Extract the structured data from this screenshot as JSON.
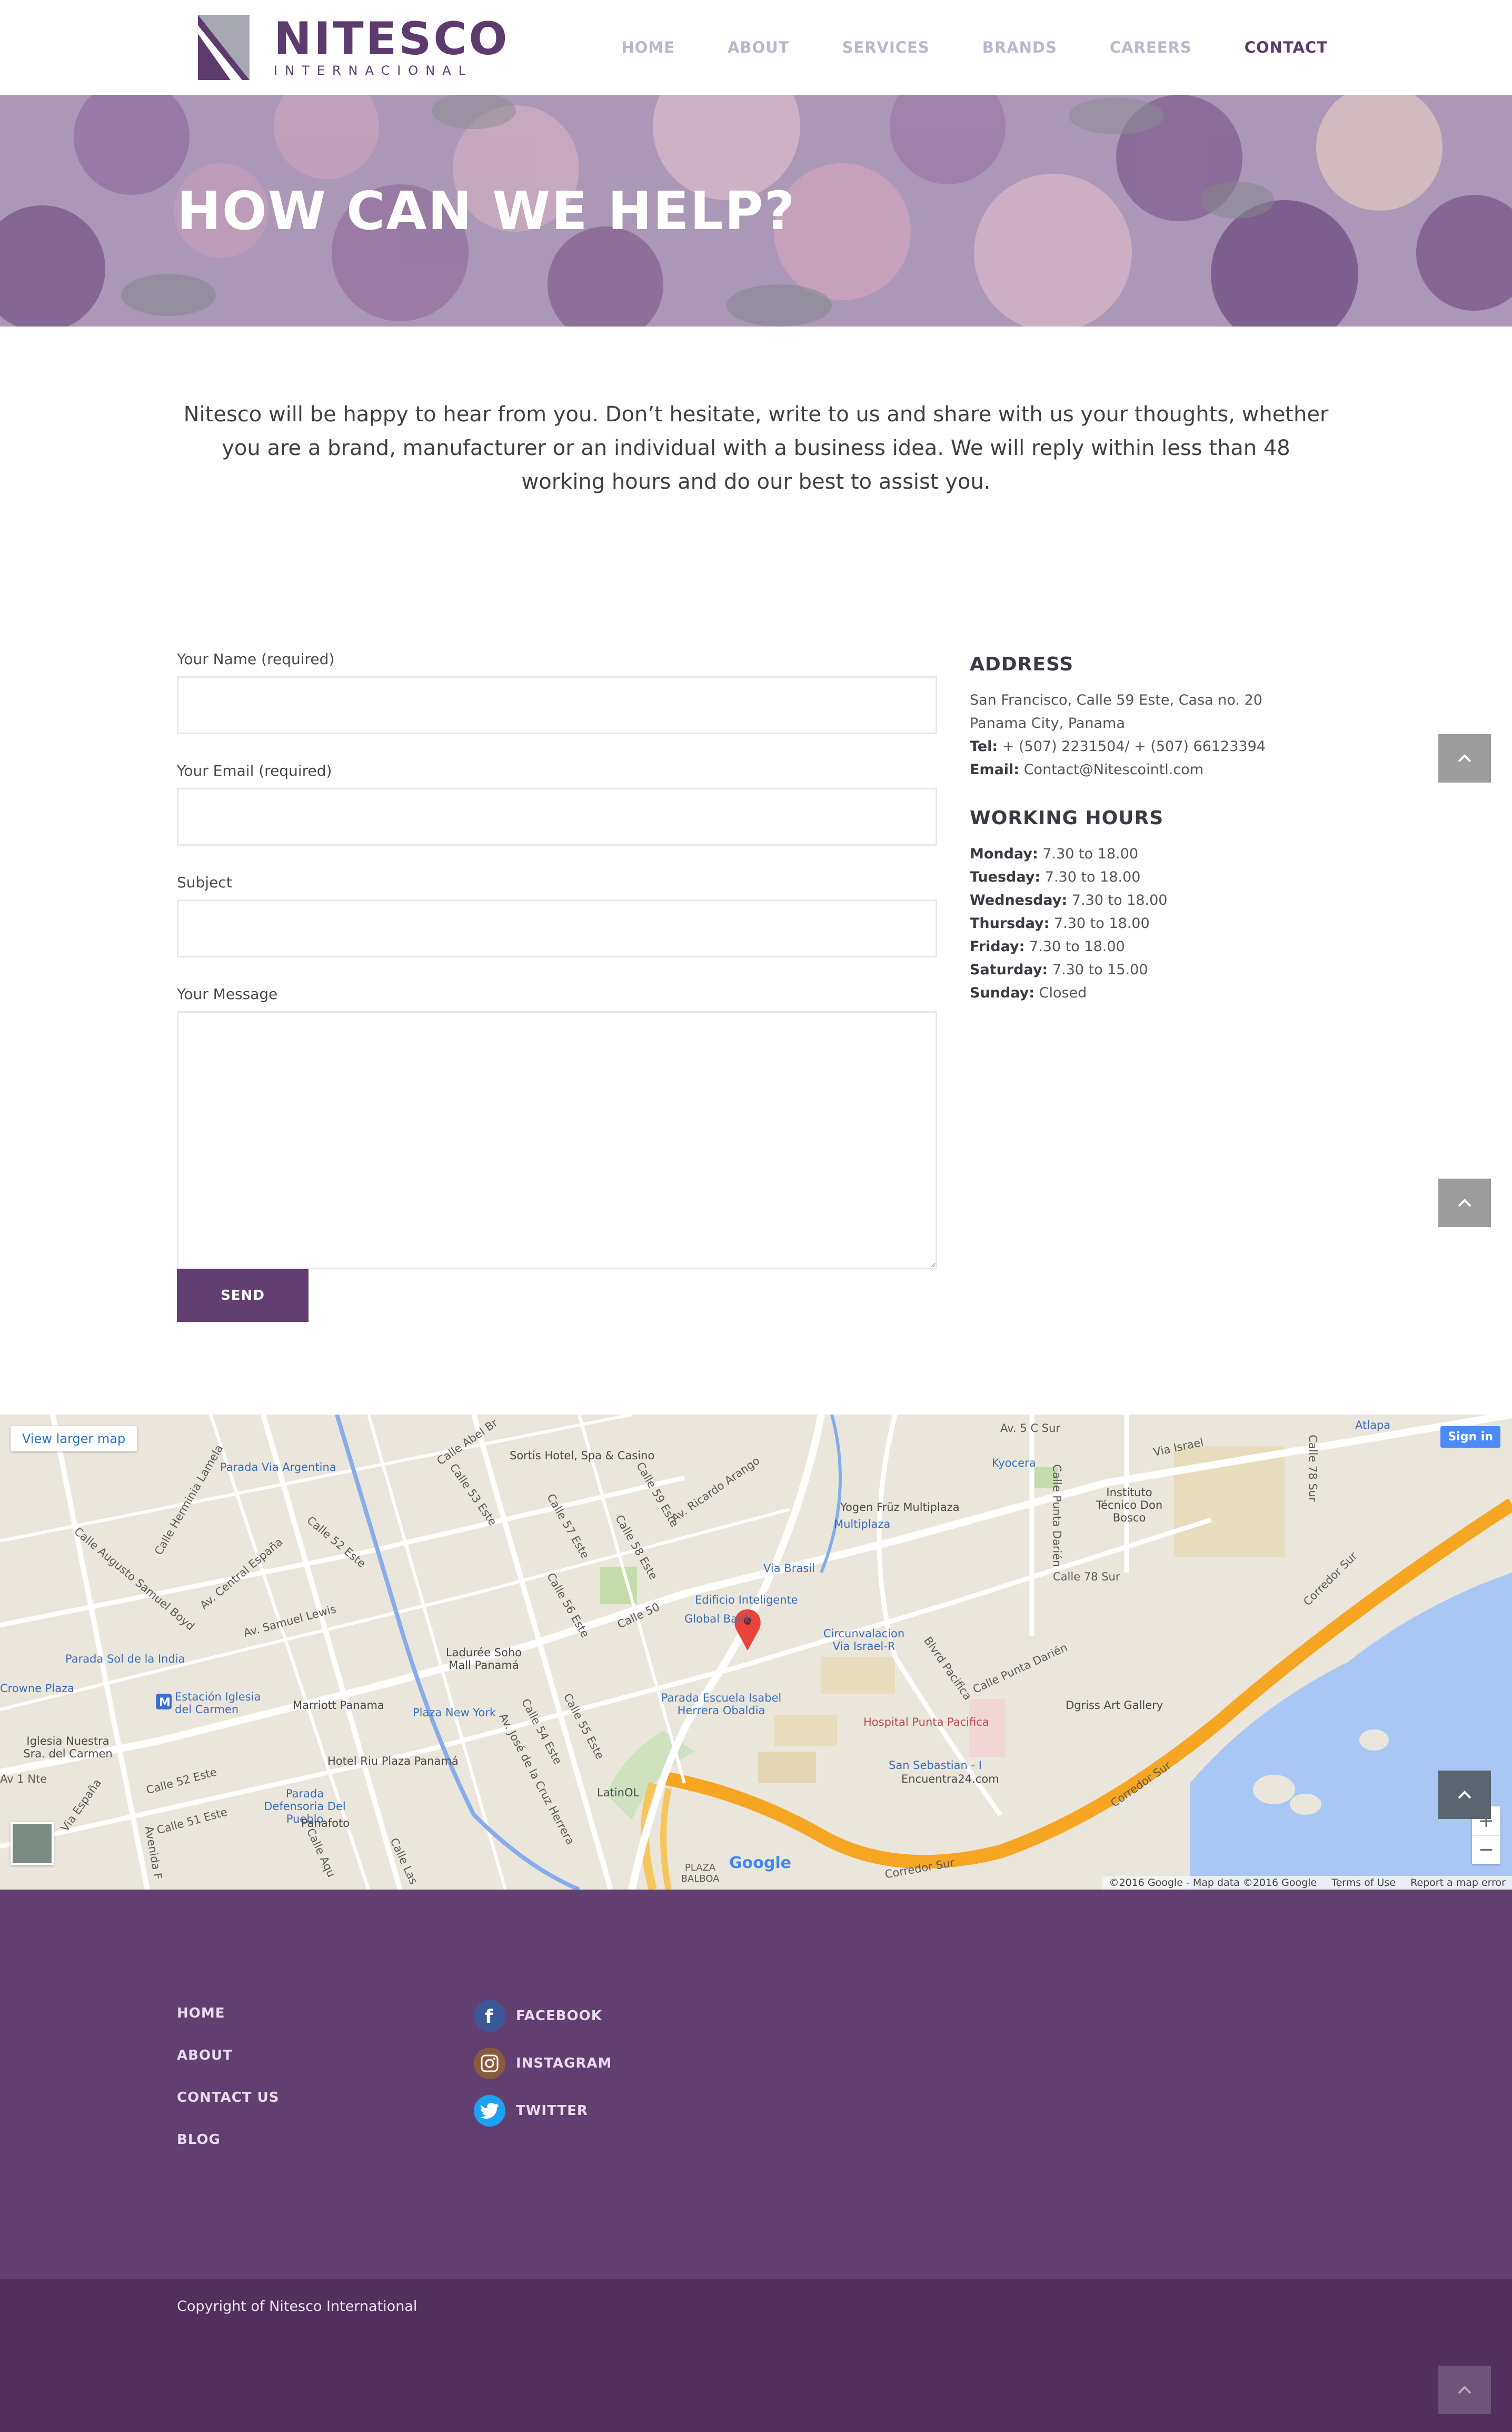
{
  "brand": {
    "name": "NITESCO",
    "tagline": "INTERNACIONAL"
  },
  "nav": {
    "items": [
      {
        "label": "HOME",
        "active": false
      },
      {
        "label": "ABOUT",
        "active": false
      },
      {
        "label": "SERVICES",
        "active": false
      },
      {
        "label": "BRANDS",
        "active": false
      },
      {
        "label": "CAREERS",
        "active": false
      },
      {
        "label": "CONTACT",
        "active": true
      }
    ]
  },
  "hero": {
    "title": "HOW CAN WE HELP?"
  },
  "intro": {
    "text": "Nitesco will be happy to hear from you. Don’t hesitate, write to us and share with us your thoughts, whether you are a brand, manufacturer or an individual with a business idea. We will reply within less than 48 working hours and do our best to assist you."
  },
  "form": {
    "name_label": "Your Name (required)",
    "name_value": "",
    "email_label": "Your Email (required)",
    "email_value": "",
    "subject_label": "Subject",
    "subject_value": "",
    "message_label": "Your Message",
    "message_value": "",
    "send_label": "SEND"
  },
  "contact": {
    "address_heading": "ADDRESS",
    "address_line1": "San Francisco, Calle 59 Este, Casa no. 20",
    "address_line2": "Panama City, Panama",
    "tel_label": "Tel:",
    "tel_value": "+ (507) 2231504/ + (507) 66123394",
    "email_label": "Email:",
    "email_value": "Contact@Nitescointl.com",
    "hours_heading": "WORKING HOURS",
    "hours": [
      {
        "day": "Monday:",
        "time": "7.30 to 18.00"
      },
      {
        "day": "Tuesday:",
        "time": "7.30 to 18.00"
      },
      {
        "day": "Wednesday:",
        "time": "7.30 to 18.00"
      },
      {
        "day": "Thursday:",
        "time": "7.30 to 18.00"
      },
      {
        "day": "Friday:",
        "time": "7.30 to 18.00"
      },
      {
        "day": "Saturday:",
        "time": "7.30 to 15.00"
      },
      {
        "day": "Sunday:",
        "time": "Closed"
      }
    ]
  },
  "map": {
    "view_larger": "View larger map",
    "sign_in": "Sign in",
    "zoom_in": "+",
    "zoom_out": "−",
    "attribution": "©2016 Google - Map data ©2016 Google",
    "terms": "Terms of Use",
    "report": "Report a map error",
    "google": "Google",
    "labels": {
      "parada_via_argentina": "Parada Via Argentina",
      "sortis": "Sortis Hotel, Spa & Casino",
      "calle_abel": "Calle Abel Br",
      "av_ricardo_arango": "Av. Ricardo Arango",
      "calle_53_este": "Calle 53 Este",
      "calle_52_este": "Calle 52 Este",
      "calle_57_este": "Calle 57 Este",
      "calle_58_este": "Calle 58 Este",
      "calle_59_este": "Calle 59 Este",
      "calle_56_este": "Calle 56 Este",
      "calle_50": "Calle 50",
      "edificio_inteligente": "Edificio Inteligente",
      "global_bank": "Global Bank",
      "via_brasil": "Via Brasil",
      "yogen": "Yogen Früz Multiplaza",
      "multiplaza": "Multiplaza",
      "kyocera": "Kyocera",
      "instituto": "Instituto Técnico Don Bosco",
      "via_israel": "Via Israel",
      "av_5c_sur": "Av. 5 C Sur",
      "atlapa": "Atlapa",
      "calle_78_sur": "Calle 78 Sur",
      "calle_punta_darien": "Calle Punta Darién",
      "circunvalacion": "Circunvalacion Via Israel-R",
      "bvld_pacifica": "Blvrd Pacifica",
      "hospital": "Hospital Punta Pacifica",
      "dgriss": "Dgriss Art Gallery",
      "corredor_sur": "Corredor Sur",
      "san_sebastian": "San Sebastian - I",
      "encuentra24": "Encuentra24.com",
      "parada_escuela": "Parada Escuela Isabel Herrera Obaldia",
      "laduree": "Ladurée Soho Mall Panamá",
      "marriott": "Marriott Panama",
      "plaza_new_york": "Plaza New York",
      "av_jose": "Av. José de la Cruz Herrera",
      "calle_55_este": "Calle 55 Este",
      "calle_54_este": "Calle 54 Este",
      "latinol": "LatinOL",
      "hotel_riu": "Hotel Riu Plaza Panamá",
      "parada_defensoria": "Parada Defensoria Del Pueblo",
      "panafoto": "Panafoto",
      "estacion_iglesia": "Estación Iglesia del Carmen",
      "parada_sol": "Parada Sol de la India",
      "crowne_plaza": "Crowne Plaza",
      "iglesia_nuestra": "Iglesia Nuestra Sra. del Carmen",
      "av_samuel_lewis": "Av. Samuel Lewis",
      "calle_herminia": "Calle Herminia Lamela",
      "calle_augusto": "Calle Augusto Samuel Boyd",
      "av_central_espana": "Av. Central España",
      "calle_51_este": "Calle 51 Este",
      "av_1_nte": "Av 1 Nte",
      "plaza_balboa": "PLAZA BALBOA",
      "via_espana": "Via España",
      "avenida_f": "Avenida F",
      "calle_aquilino": "Calle Aqu",
      "calle_las": "Calle Las"
    }
  },
  "footer": {
    "links": [
      "HOME",
      "ABOUT",
      "CONTACT US",
      "BLOG"
    ],
    "social": [
      {
        "label": "FACEBOOK",
        "icon": "facebook-icon",
        "color": "#3b5998"
      },
      {
        "label": "INSTAGRAM",
        "icon": "instagram-icon",
        "color": "#8a5a3c"
      },
      {
        "label": "TWITTER",
        "icon": "twitter-icon",
        "color": "#1da1f2"
      }
    ],
    "copyright": "Copyright of Nitesco International"
  },
  "colors": {
    "brand_purple": "#5e3b6e",
    "button_purple": "#623f72",
    "footer_purple": "#623f71",
    "bottom_bar_purple": "#51305e",
    "nav_inactive": "#b8b8cc",
    "scroll_button_gray": "#9c9c9c"
  }
}
